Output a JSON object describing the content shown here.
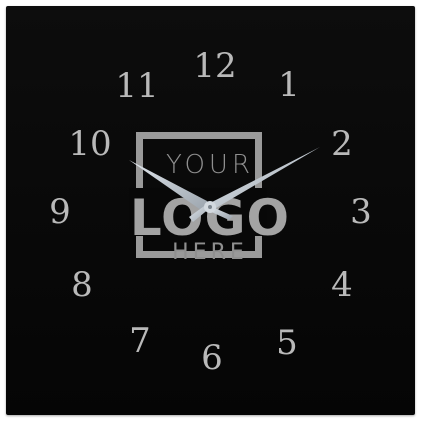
{
  "clock": {
    "numerals": [
      "12",
      "1",
      "2",
      "3",
      "4",
      "5",
      "6",
      "7",
      "8",
      "9",
      "10",
      "11"
    ],
    "time": {
      "hour": 10,
      "minute": 10
    }
  },
  "logo": {
    "top": "YOUR",
    "main": "LOGO",
    "bottom": "HERE"
  },
  "colors": {
    "face": "#0a0a0a",
    "numerals": "#b9b9b9",
    "hands": "#c8d0d8",
    "logo": "#9a9a9a"
  }
}
